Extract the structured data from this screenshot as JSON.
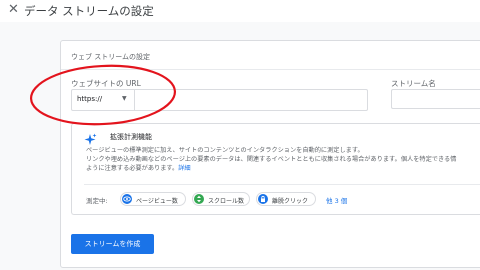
{
  "header": {
    "close_icon": "close-icon",
    "title": "データ ストリームの設定"
  },
  "card": {
    "title": "ウェブ ストリームの設定",
    "url_label": "ウェブサイトの URL",
    "protocol_value": "https://",
    "url_value": "",
    "stream_name_label": "ストリーム名",
    "stream_name_value": ""
  },
  "enhanced": {
    "icon": "sparkle-icon",
    "title": "拡張計測機能",
    "line1": "ページビューの標準測定に加え、サイトのコンテンツとのインタラクションを自動的に測定します。",
    "line2": "リンクや埋め込み動画などのページ上の要素のデータは、関連するイベントとともに収集される場合があります。個人を特定できる情",
    "line3": "ように注意する必要があります。",
    "details_link": "詳細",
    "measuring_label": "測定中:",
    "chips": [
      {
        "label": "ページビュー数",
        "icon": "eye-icon",
        "color": "#1a73e8"
      },
      {
        "label": "スクロール数",
        "icon": "scroll-icon",
        "color": "#34a853"
      },
      {
        "label": "離脱クリック",
        "icon": "lock-icon",
        "color": "#1a73e8"
      }
    ],
    "more_link": "他 3 個"
  },
  "actions": {
    "create_label": "ストリームを作成"
  },
  "annotation": {
    "color": "#e3141d"
  }
}
